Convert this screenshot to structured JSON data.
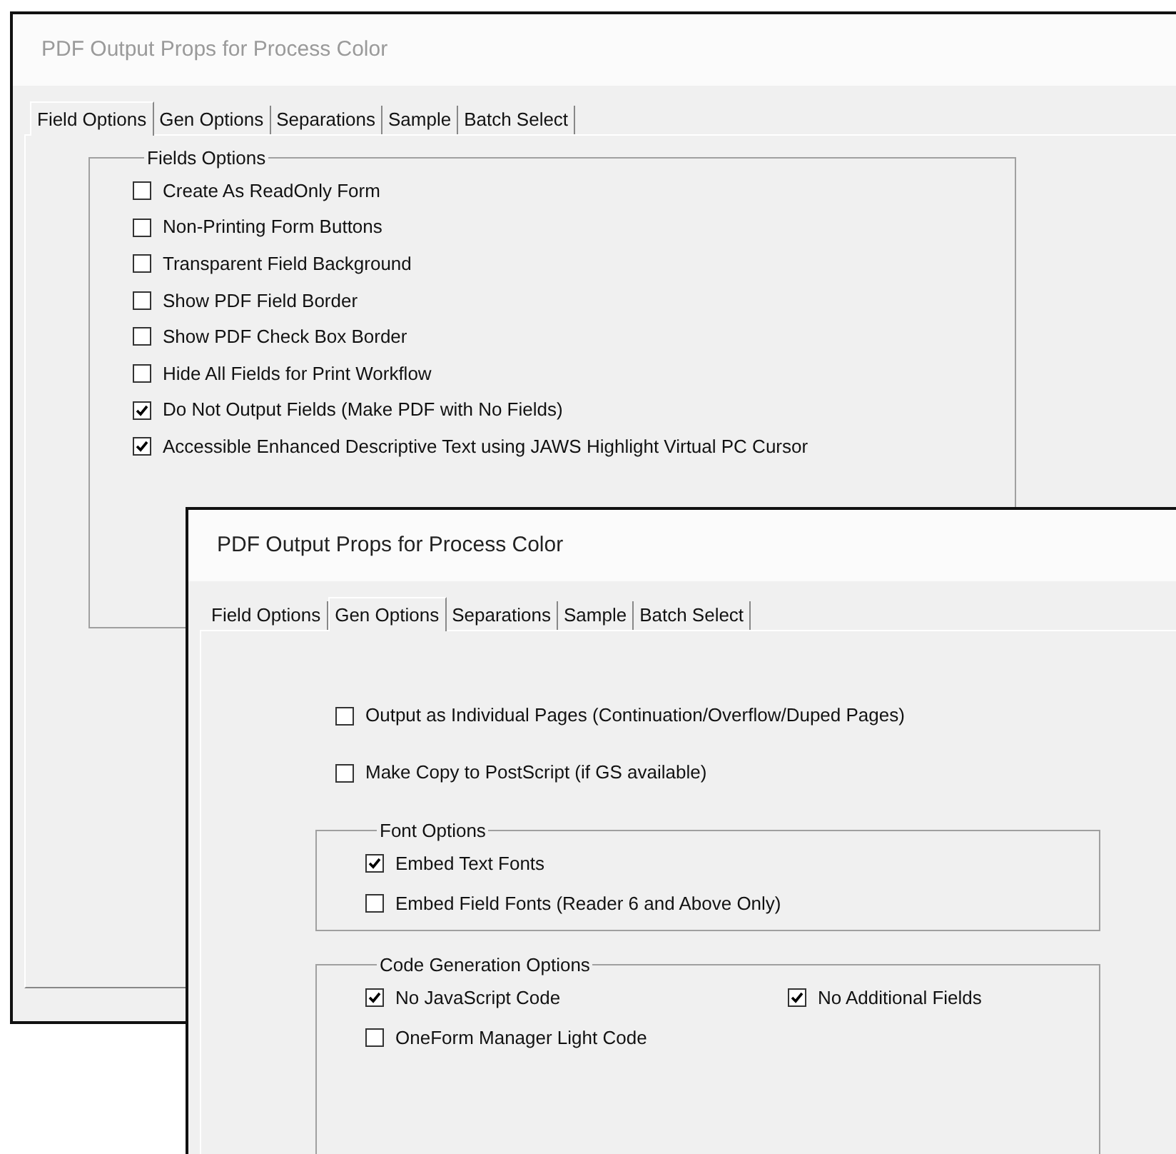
{
  "windows": [
    {
      "title": "PDF Output Props for Process Color",
      "active": false,
      "tabs": [
        {
          "label": "Field Options",
          "selected": true
        },
        {
          "label": "Gen Options",
          "selected": false
        },
        {
          "label": "Separations",
          "selected": false
        },
        {
          "label": "Sample",
          "selected": false
        },
        {
          "label": "Batch Select",
          "selected": false
        }
      ],
      "sections": [
        {
          "kind": "group",
          "title": "Fields Options",
          "rows": [
            [
              {
                "label": "Create As ReadOnly Form",
                "checked": false
              }
            ],
            [
              {
                "label": "Non-Printing Form Buttons",
                "checked": false
              }
            ],
            [
              {
                "label": "Transparent Field Background",
                "checked": false
              }
            ],
            [
              {
                "label": "Show PDF Field Border",
                "checked": false
              }
            ],
            [
              {
                "label": "Show PDF Check Box Border",
                "checked": false
              }
            ],
            [
              {
                "label": "Hide All Fields for Print Workflow",
                "checked": false
              }
            ],
            [
              {
                "label": "Do Not Output Fields (Make PDF with No Fields)",
                "checked": true
              }
            ],
            [
              {
                "label": "Accessible Enhanced Descriptive Text using JAWS Highlight Virtual PC Cursor",
                "checked": true
              }
            ]
          ]
        }
      ]
    },
    {
      "title": "PDF Output Props for Process Color",
      "active": true,
      "tabs": [
        {
          "label": "Field Options",
          "selected": false
        },
        {
          "label": "Gen Options",
          "selected": true
        },
        {
          "label": "Separations",
          "selected": false
        },
        {
          "label": "Sample",
          "selected": false
        },
        {
          "label": "Batch Select",
          "selected": false
        }
      ],
      "sections": [
        {
          "kind": "checkbox",
          "label": "Output as Individual Pages (Continuation/Overflow/Duped Pages)",
          "checked": false
        },
        {
          "kind": "checkbox",
          "label": "Make Copy to PostScript (if GS available)",
          "checked": false
        },
        {
          "kind": "group",
          "title": "Font Options",
          "rows": [
            [
              {
                "label": "Embed Text Fonts",
                "checked": true
              }
            ],
            [
              {
                "label": "Embed Field Fonts (Reader 6 and Above Only)",
                "checked": false
              }
            ]
          ]
        },
        {
          "kind": "group",
          "title": "Code Generation Options",
          "rows": [
            [
              {
                "label": "No JavaScript Code",
                "checked": true
              },
              {
                "label": "No Additional Fields",
                "checked": true
              }
            ],
            [
              {
                "label": "OneForm Manager Light Code",
                "checked": false
              }
            ]
          ]
        }
      ]
    }
  ]
}
